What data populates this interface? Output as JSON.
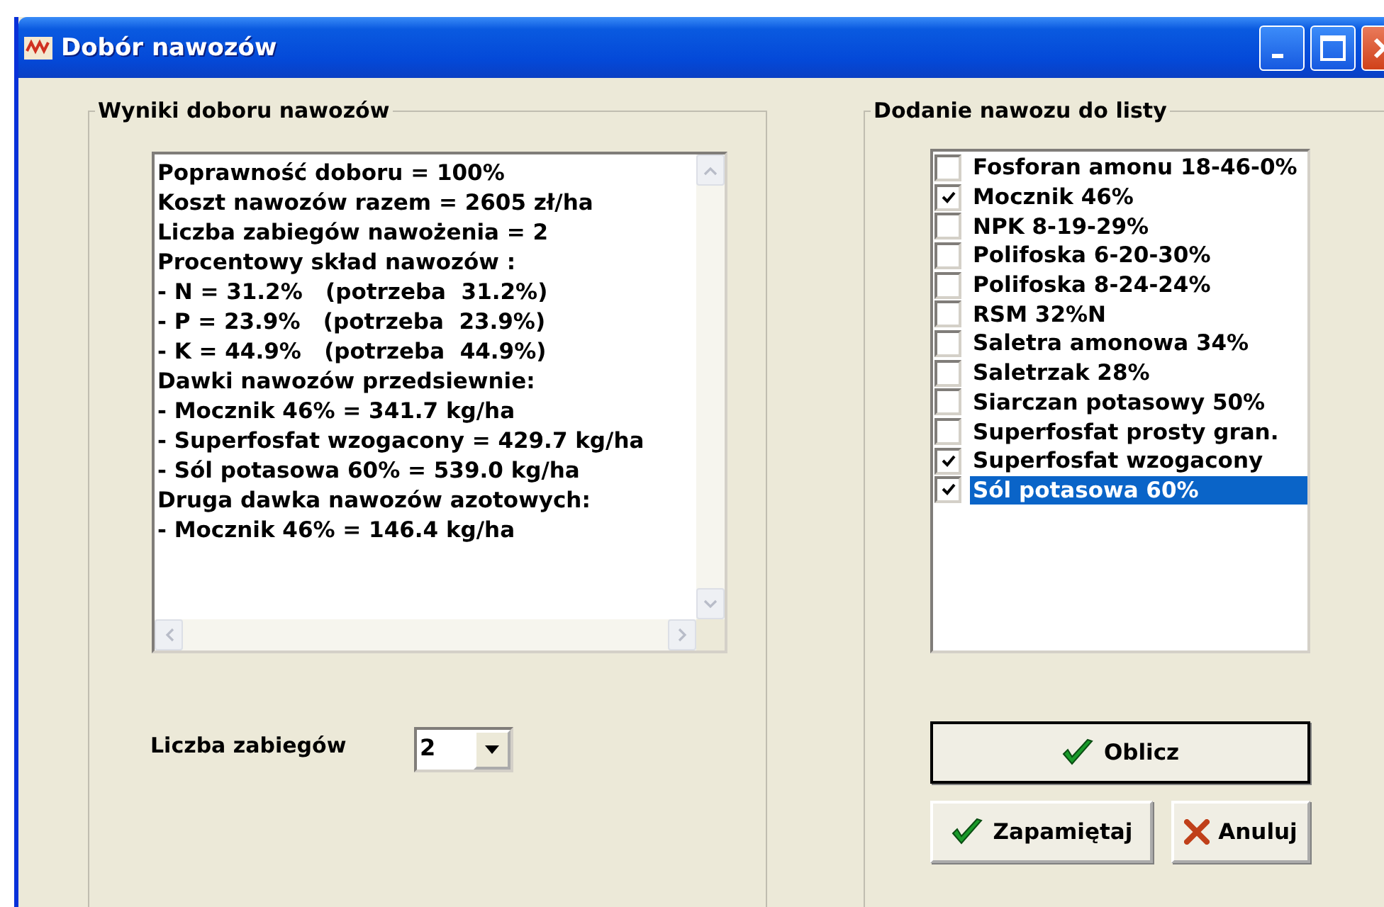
{
  "window": {
    "title": "Dobór nawozów"
  },
  "results": {
    "title": "Wyniki doboru nawozów",
    "lines": [
      "Poprawność doboru = 100%",
      "Koszt nawozów razem = 2605 zł/ha",
      "Liczba zabiegów nawożenia = 2",
      "Procentowy skład nawozów :",
      "- N = 31.2%   (potrzeba  31.2%)",
      "- P = 23.9%   (potrzeba  23.9%)",
      "- K = 44.9%   (potrzeba  44.9%)",
      "Dawki nawozów przedsiewnie:",
      "- Mocznik 46% = 341.7 kg/ha",
      "- Superfosfat wzogacony = 429.7 kg/ha",
      "- Sól potasowa 60% = 539.0 kg/ha",
      "Druga dawka nawozów azotowych:",
      "- Mocznik 46% = 146.4 kg/ha"
    ],
    "treatments": {
      "label": "Liczba zabiegów",
      "value": "2"
    }
  },
  "fertilizers": {
    "title": "Dodanie nawozu do listy",
    "items": [
      {
        "label": "Fosforan amonu 18-46-0%",
        "checked": false,
        "selected": false
      },
      {
        "label": "Mocznik 46%",
        "checked": true,
        "selected": false
      },
      {
        "label": "NPK 8-19-29%",
        "checked": false,
        "selected": false
      },
      {
        "label": "Polifoska 6-20-30%",
        "checked": false,
        "selected": false
      },
      {
        "label": "Polifoska 8-24-24%",
        "checked": false,
        "selected": false
      },
      {
        "label": "RSM 32%N",
        "checked": false,
        "selected": false
      },
      {
        "label": "Saletra amonowa 34%",
        "checked": false,
        "selected": false
      },
      {
        "label": "Saletrzak 28%",
        "checked": false,
        "selected": false
      },
      {
        "label": "Siarczan potasowy 50%",
        "checked": false,
        "selected": false
      },
      {
        "label": "Superfosfat prosty gran.",
        "checked": false,
        "selected": false
      },
      {
        "label": "Superfosfat wzogacony",
        "checked": true,
        "selected": false
      },
      {
        "label": "Sól potasowa 60%",
        "checked": true,
        "selected": true
      }
    ]
  },
  "buttons": [
    {
      "kind": "calculate",
      "label": "Oblicz"
    },
    {
      "kind": "save",
      "label": "Zapamiętaj"
    },
    {
      "kind": "cancel",
      "label": "Anuluj"
    }
  ]
}
